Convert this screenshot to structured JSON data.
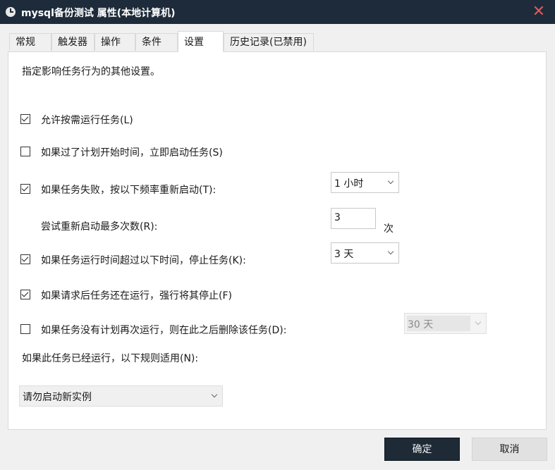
{
  "window": {
    "title": "mysql备份测试 属性(本地计算机)",
    "close": "✕"
  },
  "tabs": [
    "常规",
    "触发器",
    "操作",
    "条件",
    "设置",
    "历史记录(已禁用)"
  ],
  "active_tab": "设置",
  "settings": {
    "description": "指定影响任务行为的其他设置。",
    "allow_on_demand": {
      "label": "允许按需运行任务(L)",
      "checked": true
    },
    "run_asap": {
      "label": "如果过了计划开始时间，立即启动任务(S)",
      "checked": false
    },
    "restart_on_failure": {
      "label": "如果任务失败，按以下频率重新启动(T):",
      "checked": true,
      "interval": "1 小时"
    },
    "restart_attempts": {
      "label": "尝试重新启动最多次数(R):",
      "value": "3",
      "unit": "次"
    },
    "stop_if_runs_longer": {
      "label": "如果任务运行时间超过以下时间，停止任务(K):",
      "checked": true,
      "duration": "3 天"
    },
    "force_stop": {
      "label": "如果请求后任务还在运行，强行将其停止(F)",
      "checked": true
    },
    "delete_if_not_scheduled": {
      "label": "如果任务没有计划再次运行，则在此之后删除该任务(D):",
      "checked": false,
      "duration": "30 天"
    },
    "already_running_rule": {
      "label": "如果此任务已经运行，以下规则适用(N):",
      "value": "请勿启动新实例"
    }
  },
  "buttons": {
    "ok": "确定",
    "cancel": "取消"
  }
}
